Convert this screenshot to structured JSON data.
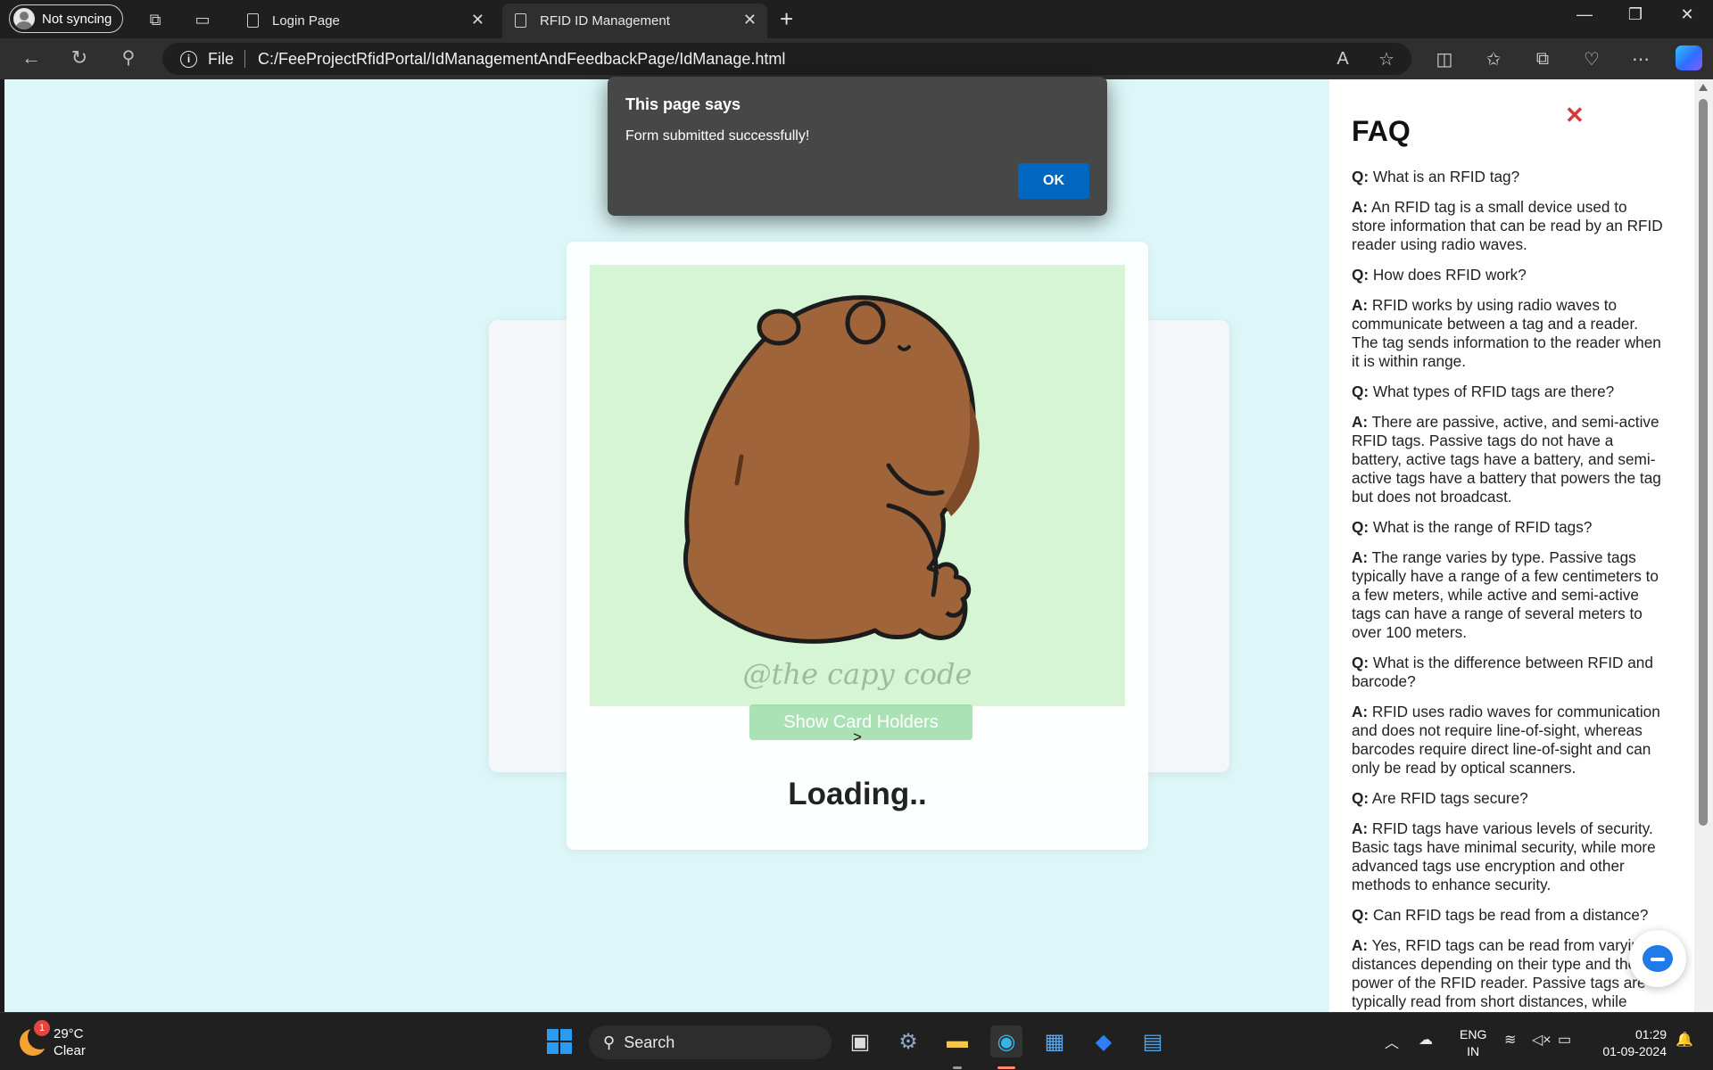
{
  "browser": {
    "profile_label": "Not syncing",
    "tabs": [
      {
        "title": "Login Page",
        "active": false
      },
      {
        "title": "RFID ID Management",
        "active": true
      }
    ],
    "address": {
      "scheme_label": "File",
      "url": "C:/FeeProjectRfidPortal/IdManagementAndFeedbackPage/IdManage.html"
    }
  },
  "dialog": {
    "title": "This page says",
    "message": "Form submitted successfully!",
    "ok_label": "OK"
  },
  "main": {
    "watermark": "@the capy code",
    "show_button_label": "Show Card Holders",
    "arrow_text": ">",
    "loading_text": "Loading.."
  },
  "faq": {
    "close_glyph": "✕",
    "title": "FAQ",
    "items": [
      {
        "q": "What is an RFID tag?",
        "a": "An RFID tag is a small device used to store information that can be read by an RFID reader using radio waves."
      },
      {
        "q": "How does RFID work?",
        "a": "RFID works by using radio waves to communicate between a tag and a reader. The tag sends information to the reader when it is within range."
      },
      {
        "q": "What types of RFID tags are there?",
        "a": "There are passive, active, and semi-active RFID tags. Passive tags do not have a battery, active tags have a battery, and semi-active tags have a battery that powers the tag but does not broadcast."
      },
      {
        "q": "What is the range of RFID tags?",
        "a": "The range varies by type. Passive tags typically have a range of a few centimeters to a few meters, while active and semi-active tags can have a range of several meters to over 100 meters."
      },
      {
        "q": "What is the difference between RFID and barcode?",
        "a": "RFID uses radio waves for communication and does not require line-of-sight, whereas barcodes require direct line-of-sight and can only be read by optical scanners."
      },
      {
        "q": "Are RFID tags secure?",
        "a": "RFID tags have various levels of security. Basic tags have minimal security, while more advanced tags use encryption and other methods to enhance security."
      },
      {
        "q": "Can RFID tags be read from a distance?",
        "a": "Yes, RFID tags can be read from varying distances depending on their type and the power of the RFID reader. Passive tags are typically read from short distances, while"
      }
    ]
  },
  "taskbar": {
    "weather": {
      "temp": "29°C",
      "condition": "Clear",
      "badge": "1"
    },
    "search_placeholder": "Search",
    "lang_line1": "ENG",
    "lang_line2": "IN",
    "time": "01:29",
    "date": "01-09-2024"
  },
  "colors": {
    "page_bg": "#ddf7f8",
    "ok_button": "#0067c0",
    "faq_close": "#d23a3a",
    "show_button": "#86d696"
  }
}
